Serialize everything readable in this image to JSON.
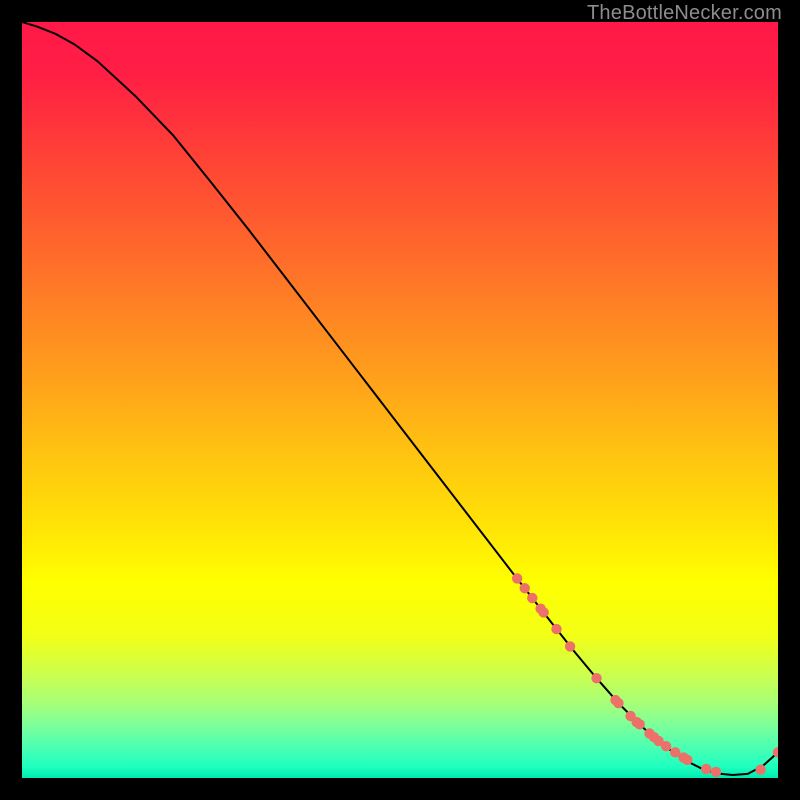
{
  "watermark": {
    "text": "TheBottleNecker.com"
  },
  "chart_data": {
    "type": "line",
    "title": "",
    "xlabel": "",
    "ylabel": "",
    "xlim": [
      0,
      100
    ],
    "ylim": [
      0,
      100
    ],
    "grid": false,
    "legend": false,
    "background_gradient": {
      "stops": [
        {
          "offset": 0.0,
          "color": "#ff1848"
        },
        {
          "offset": 0.07,
          "color": "#ff1f44"
        },
        {
          "offset": 0.17,
          "color": "#ff3f37"
        },
        {
          "offset": 0.27,
          "color": "#ff5e2e"
        },
        {
          "offset": 0.37,
          "color": "#ff7f25"
        },
        {
          "offset": 0.47,
          "color": "#ffa01b"
        },
        {
          "offset": 0.57,
          "color": "#ffc310"
        },
        {
          "offset": 0.67,
          "color": "#ffe406"
        },
        {
          "offset": 0.74,
          "color": "#ffff00"
        },
        {
          "offset": 0.81,
          "color": "#f3ff15"
        },
        {
          "offset": 0.86,
          "color": "#ceff4a"
        },
        {
          "offset": 0.9,
          "color": "#a8ff77"
        },
        {
          "offset": 0.93,
          "color": "#7dff9a"
        },
        {
          "offset": 0.96,
          "color": "#4affb2"
        },
        {
          "offset": 0.985,
          "color": "#1effc0"
        },
        {
          "offset": 1.0,
          "color": "#00ebb1"
        }
      ]
    },
    "series": [
      {
        "name": "bottleneck-curve",
        "color": "#000000",
        "x": [
          0,
          2,
          4.5,
          7,
          10,
          15,
          20,
          25,
          30,
          35,
          40,
          45,
          50,
          55,
          60,
          65,
          70,
          73,
          76,
          79,
          82,
          85,
          88,
          90,
          92,
          94,
          96,
          98,
          100
        ],
        "y": [
          100,
          99.4,
          98.4,
          97.0,
          94.8,
          90.2,
          85.0,
          78.8,
          72.5,
          66.0,
          59.5,
          53.0,
          46.5,
          40.0,
          33.5,
          27.0,
          20.6,
          16.8,
          13.2,
          9.8,
          6.8,
          4.2,
          2.2,
          1.2,
          0.6,
          0.4,
          0.55,
          1.6,
          3.4
        ]
      }
    ],
    "scatter_points": {
      "name": "data-points",
      "color": "#ed7168",
      "radius": 5.2,
      "x": [
        65.5,
        66.5,
        67.5,
        68.6,
        69.0,
        70.7,
        72.5,
        76.0,
        78.5,
        78.9,
        80.5,
        81.3,
        81.7,
        83.0,
        83.6,
        84.2,
        85.2,
        86.4,
        87.5,
        88.0,
        90.5,
        91.8,
        97.7,
        100.0
      ],
      "y": [
        26.4,
        25.1,
        23.8,
        22.4,
        21.9,
        19.7,
        17.4,
        13.2,
        10.3,
        9.9,
        8.2,
        7.4,
        7.1,
        5.9,
        5.4,
        4.9,
        4.2,
        3.4,
        2.7,
        2.4,
        1.2,
        0.8,
        1.1,
        3.4
      ]
    }
  }
}
